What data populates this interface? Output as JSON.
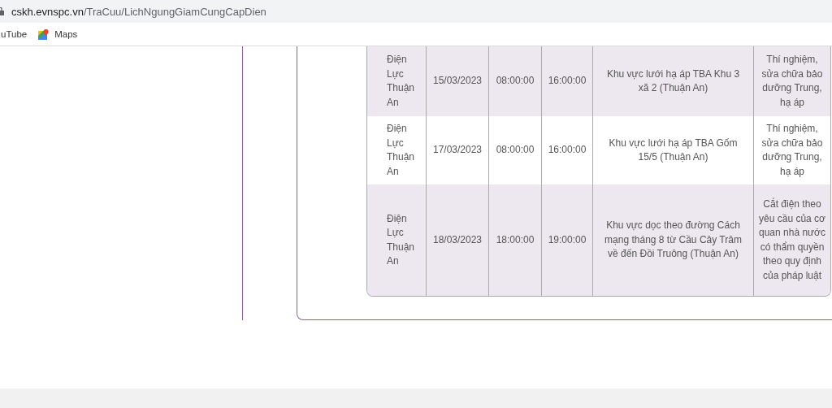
{
  "address_bar": {
    "host": "cskh.evnspc.vn",
    "path": "/TraCuu/LichNgungGiamCungCapDien"
  },
  "bookmarks": [
    {
      "label": "uTube",
      "kind": "text"
    },
    {
      "label": "Maps",
      "kind": "maps"
    }
  ],
  "table": {
    "rows": [
      {
        "cells": [
          "Điện Lực Thuận An",
          "15/03/2023",
          "08:00:00",
          "16:00:00",
          "Khu vực lưới hạ áp TBA Khu 3 xã 2 (Thuận An)",
          "Thí nghiệm, sửa chữa bảo dưỡng Trung, hạ áp"
        ]
      },
      {
        "cells": [
          "Điện Lực Thuận An",
          "17/03/2023",
          "08:00:00",
          "16:00:00",
          "Khu vực lưới hạ áp TBA Gốm 15/5 (Thuận An)",
          "Thí nghiệm, sửa chữa bảo dưỡng Trung, hạ áp"
        ]
      },
      {
        "cells": [
          "Điện Lực Thuận An",
          "18/03/2023",
          "18:00:00",
          "19:00:00",
          "Khu vực dọc theo đường Cách mạng tháng 8 từ Cầu Cây Trâm về đến Đồi Truông (Thuận An)",
          "Cắt điện theo yêu cầu của cơ quan nhà nước có thẩm quyền theo quy định của pháp luật"
        ]
      }
    ]
  }
}
